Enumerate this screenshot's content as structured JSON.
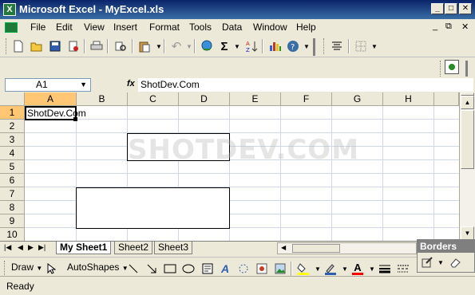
{
  "window": {
    "title": "Microsoft Excel - MyExcel.xls",
    "app_icon_letter": "X",
    "controls": [
      "_",
      "□",
      "✕"
    ]
  },
  "menu": {
    "items": [
      "File",
      "Edit",
      "View",
      "Insert",
      "Format",
      "Tools",
      "Data",
      "Window",
      "Help"
    ],
    "doc_controls": [
      "_",
      "⧉",
      "✕"
    ]
  },
  "toolbar": {
    "icons": [
      "new-icon",
      "open-icon",
      "save-icon",
      "permission-icon",
      "print-icon",
      "research-icon",
      "paste-icon",
      "undo-icon",
      "hyperlink-icon",
      "autosum-icon",
      "sort-icon",
      "chart-icon",
      "help-icon",
      "align-icon",
      "borders-icon"
    ],
    "sigma": "Σ"
  },
  "formula_bar": {
    "name_box": "A1",
    "fx_label": "fx",
    "content": "ShotDev.Com"
  },
  "grid": {
    "columns": [
      "A",
      "B",
      "C",
      "D",
      "E",
      "F",
      "G",
      "H"
    ],
    "rows": [
      "1",
      "2",
      "3",
      "4",
      "5",
      "6",
      "7",
      "8",
      "9",
      "10"
    ],
    "selected_column": "A",
    "selected_row": "1",
    "cell_a1": "ShotDev.Com",
    "watermark": "SHOTDEV.COM"
  },
  "sheets": {
    "tabs": [
      "My Sheet1",
      "Sheet2",
      "Sheet3"
    ],
    "active": "My Sheet1"
  },
  "borders_toolbar": {
    "title": "Borders"
  },
  "drawing_toolbar": {
    "draw_label": "Draw",
    "autoshapes_label": "AutoShapes"
  },
  "status": {
    "text": "Ready"
  },
  "colors": {
    "title_bar": "#0A246A",
    "selected_header": "#FFC673",
    "fill_color": "#FFFF00",
    "font_color": "#FF0000"
  }
}
